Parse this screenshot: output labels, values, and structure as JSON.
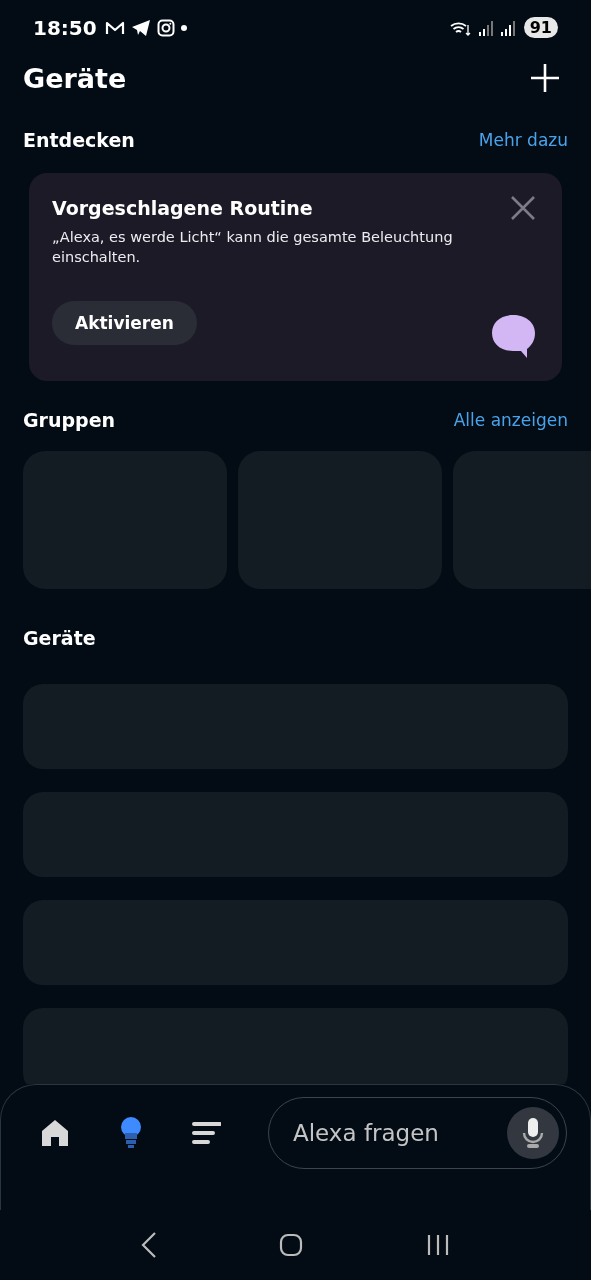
{
  "status_bar": {
    "time": "18:50",
    "battery": "91"
  },
  "header": {
    "title": "Geräte"
  },
  "discover": {
    "heading": "Entdecken",
    "link": "Mehr dazu",
    "card": {
      "title": "Vorgeschlagene Routine",
      "text": "„Alexa, es werde Licht“ kann die gesamte Beleuchtung einschalten.",
      "button": "Aktivieren"
    }
  },
  "groups": {
    "heading": "Gruppen",
    "link": "Alle anzeigen",
    "items": [
      {
        "kind": "placeholder"
      },
      {
        "kind": "placeholder"
      },
      {
        "kind": "placeholder"
      }
    ]
  },
  "devices": {
    "heading": "Geräte",
    "items": [
      {
        "kind": "placeholder"
      },
      {
        "kind": "placeholder"
      },
      {
        "kind": "placeholder"
      },
      {
        "kind": "placeholder"
      }
    ]
  },
  "bottom_nav": {
    "items": [
      {
        "kind": "home",
        "selected": false
      },
      {
        "kind": "devices",
        "selected": true
      },
      {
        "kind": "more",
        "selected": false
      }
    ],
    "search": {
      "placeholder": "Alexa fragen"
    }
  }
}
